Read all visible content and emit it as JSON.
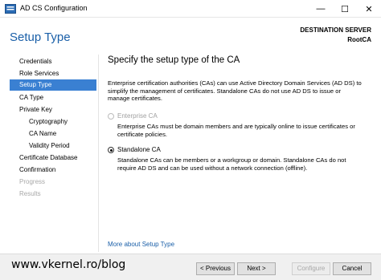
{
  "window": {
    "title": "AD CS Configuration",
    "min_glyph": "—",
    "max_glyph": "☐",
    "close_glyph": "✕"
  },
  "header": {
    "title": "Setup Type",
    "destination_label": "DESTINATION SERVER",
    "destination_name": "RootCA"
  },
  "sidebar": {
    "items": [
      {
        "label": "Credentials"
      },
      {
        "label": "Role Services"
      },
      {
        "label": "Setup Type"
      },
      {
        "label": "CA Type"
      },
      {
        "label": "Private Key"
      },
      {
        "label": "Cryptography"
      },
      {
        "label": "CA Name"
      },
      {
        "label": "Validity Period"
      },
      {
        "label": "Certificate Database"
      },
      {
        "label": "Confirmation"
      },
      {
        "label": "Progress"
      },
      {
        "label": "Results"
      }
    ],
    "selected": "Setup Type"
  },
  "main": {
    "section_title": "Specify the setup type of the CA",
    "intro": "Enterprise certification authorities (CAs) can use Active Directory Domain Services (AD DS) to simplify the management of certificates. Standalone CAs do not use AD DS to issue or manage certificates.",
    "options": [
      {
        "label": "Enterprise CA",
        "description": "Enterprise CAs must be domain members and are typically online to issue certificates or certificate policies."
      },
      {
        "label": "Standalone CA",
        "description": "Standalone CAs can be members or a workgroup or domain. Standalone CAs do not require AD DS and can be used without a network connection (offline)."
      }
    ],
    "selected_option": "Standalone CA",
    "more_link": "More about Setup Type"
  },
  "footer": {
    "watermark": "www.vkernel.ro/blog",
    "previous": "< Previous",
    "next": "Next >",
    "configure": "Configure",
    "cancel": "Cancel"
  },
  "colors": {
    "accent": "#1a5fa8",
    "selection": "#3a80d2",
    "disabled_text": "#a8a8a8"
  }
}
